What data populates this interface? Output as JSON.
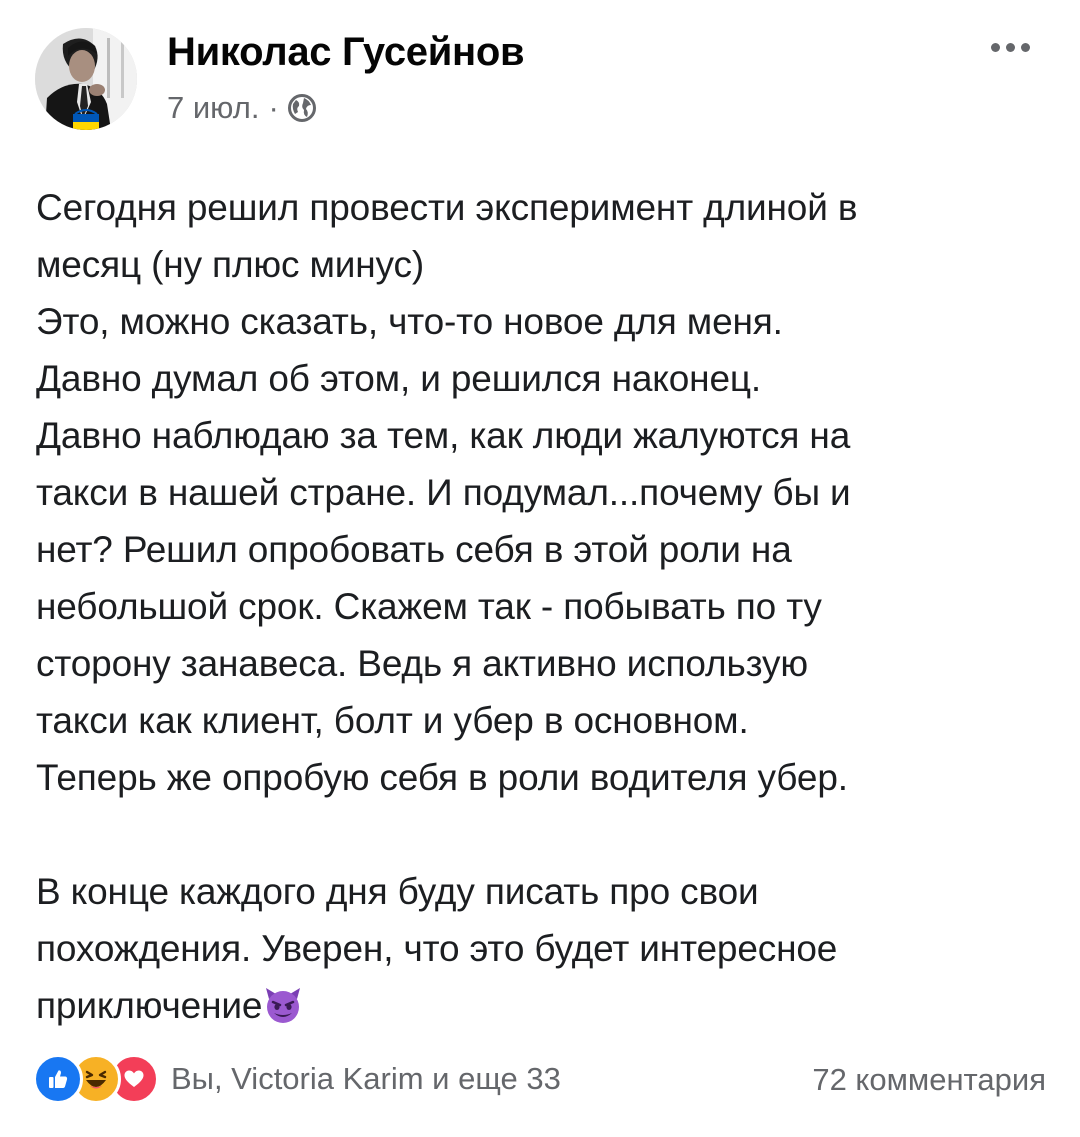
{
  "post": {
    "author_name": "Николас Гусейнов",
    "date": "7 июл.",
    "separator": "·",
    "privacy_icon": "globe-icon",
    "more_icon": "more-options-icon",
    "body_paragraph_1": [
      "Сегодня решил провести эксперимент длиной в",
      "месяц (ну плюс минус)",
      "Это, можно сказать, что-то новое для меня.",
      "Давно думал об этом, и решился наконец.",
      "Давно наблюдаю за тем, как люди жалуются на",
      "такси в нашей стране. И подумал...почему бы и",
      "нет? Решил опробовать себя в этой роли на",
      "небольшой срок. Скажем так - побывать по ту",
      "сторону занавеса. Ведь я активно использую",
      "такси как клиент, болт и убер в основном.",
      "Теперь же опробую себя в роли водителя убер."
    ],
    "body_paragraph_2": [
      "В конце каждого дня буду писать про свои",
      "похождения. Уверен, что это будет интересное",
      "приключение"
    ],
    "trailing_emoji": "smiling-devil-emoji"
  },
  "footer": {
    "reaction_icons": [
      "like-icon",
      "haha-icon",
      "love-icon"
    ],
    "reactions_text": "Вы, Victoria Karim и еще 33",
    "comments_text": "72 комментария"
  },
  "colors": {
    "like": "#1877f2",
    "haha": "#f7b125",
    "love": "#f33e58",
    "secondary_text": "#65676b",
    "ukraine_blue": "#0057b7",
    "ukraine_yellow": "#ffd700"
  }
}
